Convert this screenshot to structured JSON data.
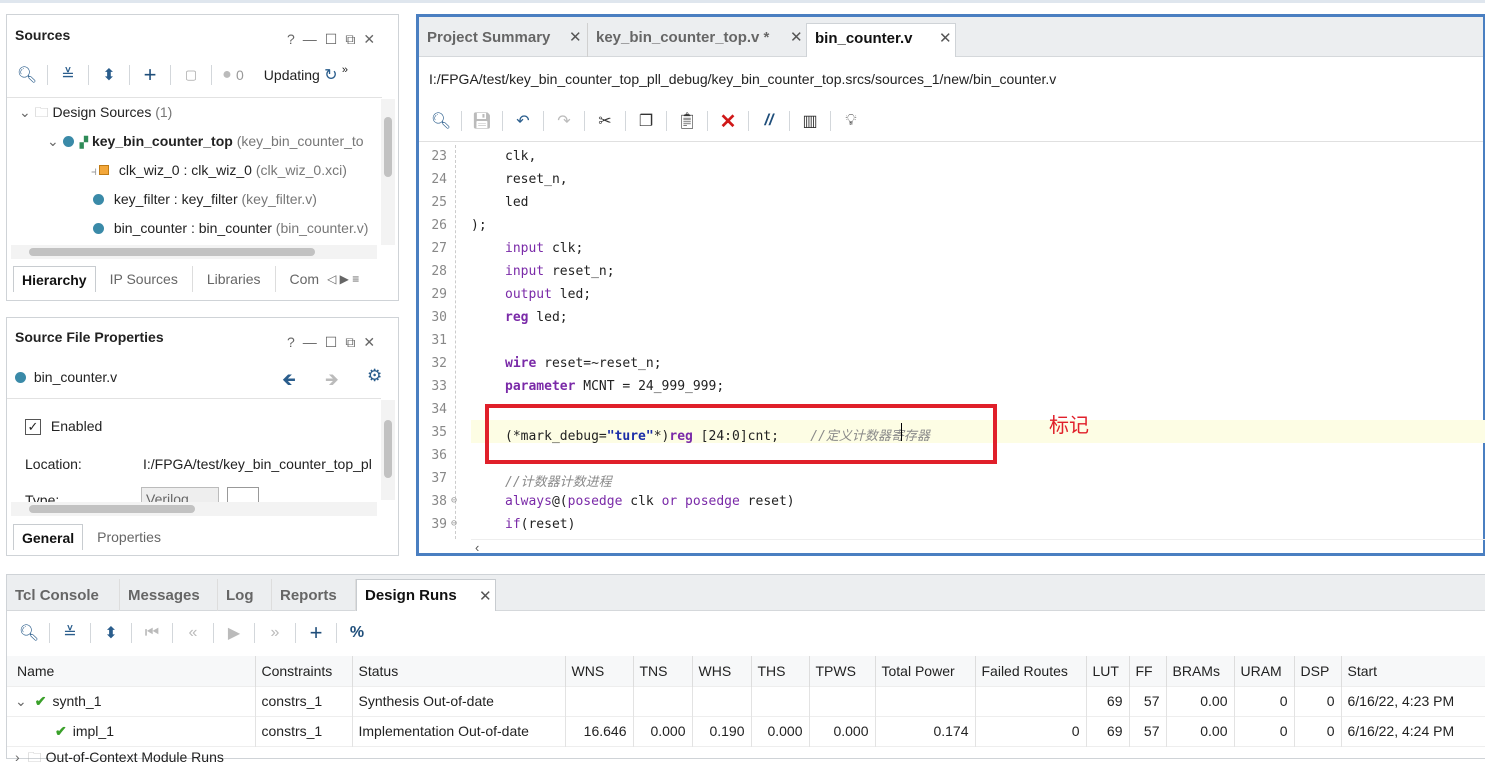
{
  "sources": {
    "title": "Sources",
    "counter": "0",
    "updating": "Updating",
    "tree": {
      "design_sources": "Design Sources",
      "design_sources_count": "(1)",
      "top_name": "key_bin_counter_top",
      "top_suffix": "(key_bin_counter_to",
      "clk_wiz": "clk_wiz_0 : clk_wiz_0",
      "clk_wiz_suffix": "(clk_wiz_0.xci)",
      "key_filter": "key_filter : key_filter",
      "key_filter_suffix": "(key_filter.v)",
      "bin_counter": "bin_counter : bin_counter",
      "bin_counter_suffix": "(bin_counter.v)"
    },
    "tabs": [
      "Hierarchy",
      "IP Sources",
      "Libraries",
      "Com"
    ]
  },
  "props": {
    "title": "Source File Properties",
    "file": "bin_counter.v",
    "enabled_label": "Enabled",
    "location_label": "Location:",
    "location_value": "I:/FPGA/test/key_bin_counter_top_pl",
    "type_label": "Type:",
    "type_value": "Verilog",
    "tabs": [
      "General",
      "Properties"
    ]
  },
  "editor": {
    "tabs": [
      "Project Summary",
      "key_bin_counter_top.v *",
      "bin_counter.v"
    ],
    "path": "I:/FPGA/test/key_bin_counter_top_pll_debug/key_bin_counter_top.srcs/sources_1/new/bin_counter.v",
    "annotation": "标记",
    "lines": {
      "n23": "23",
      "n24": "24",
      "n25": "25",
      "n26": "26",
      "n27": "27",
      "n28": "28",
      "n29": "29",
      "n30": "30",
      "n31": "31",
      "n32": "32",
      "n33": "33",
      "n34": "34",
      "n35": "35",
      "n36": "36",
      "n37": "37",
      "n38": "38",
      "n39": "39",
      "l23": "clk,",
      "l24": "reset_n,",
      "l25": "led",
      "l26": ");",
      "l27a": "input",
      "l27b": " clk;",
      "l28a": "input",
      "l28b": " reset_n;",
      "l29a": "output",
      "l29b": " led;",
      "l30a": "reg",
      "l30b": " led;",
      "l32a": "wire",
      "l32b": " reset=~reset_n;",
      "l33a": "parameter",
      "l33b": " MCNT = 24_999_999;",
      "l35a": "(*mark_debug=",
      "l35b": "\"ture\"",
      "l35c": "*)",
      "l35d": "reg",
      "l35e": " [24:0]cnt;    ",
      "l35f": "//定义计数器寄存器",
      "l37": "//计数器计数进程",
      "l38a": "always",
      "l38b": "@(",
      "l38c": "posedge",
      "l38d": " clk ",
      "l38e": "or",
      "l38f": " ",
      "l38g": "posedge",
      "l38h": " reset)",
      "l39a": "if",
      "l39b": "(reset)"
    }
  },
  "bottom": {
    "tabs": [
      "Tcl Console",
      "Messages",
      "Log",
      "Reports",
      "Design Runs"
    ],
    "columns": [
      "Name",
      "Constraints",
      "Status",
      "WNS",
      "TNS",
      "WHS",
      "THS",
      "TPWS",
      "Total Power",
      "Failed Routes",
      "LUT",
      "FF",
      "BRAMs",
      "URAM",
      "DSP",
      "Start"
    ],
    "rows": [
      [
        "synth_1",
        "constrs_1",
        "Synthesis Out-of-date",
        "",
        "",
        "",
        "",
        "",
        "",
        "",
        "69",
        "57",
        "0.00",
        "0",
        "0",
        "6/16/22, 4:23 PM"
      ],
      [
        "impl_1",
        "constrs_1",
        "Implementation Out-of-date",
        "16.646",
        "0.000",
        "0.190",
        "0.000",
        "0.000",
        "0.174",
        "0",
        "69",
        "57",
        "0.00",
        "0",
        "0",
        "6/16/22, 4:24 PM"
      ]
    ],
    "ooc": "Out-of-Context Module Runs"
  },
  "colors": {
    "accent": "#4a7fc1",
    "highlight_box": "#e0202a",
    "annotation": "#e0202a",
    "line_highlight": "#fdfde4"
  }
}
